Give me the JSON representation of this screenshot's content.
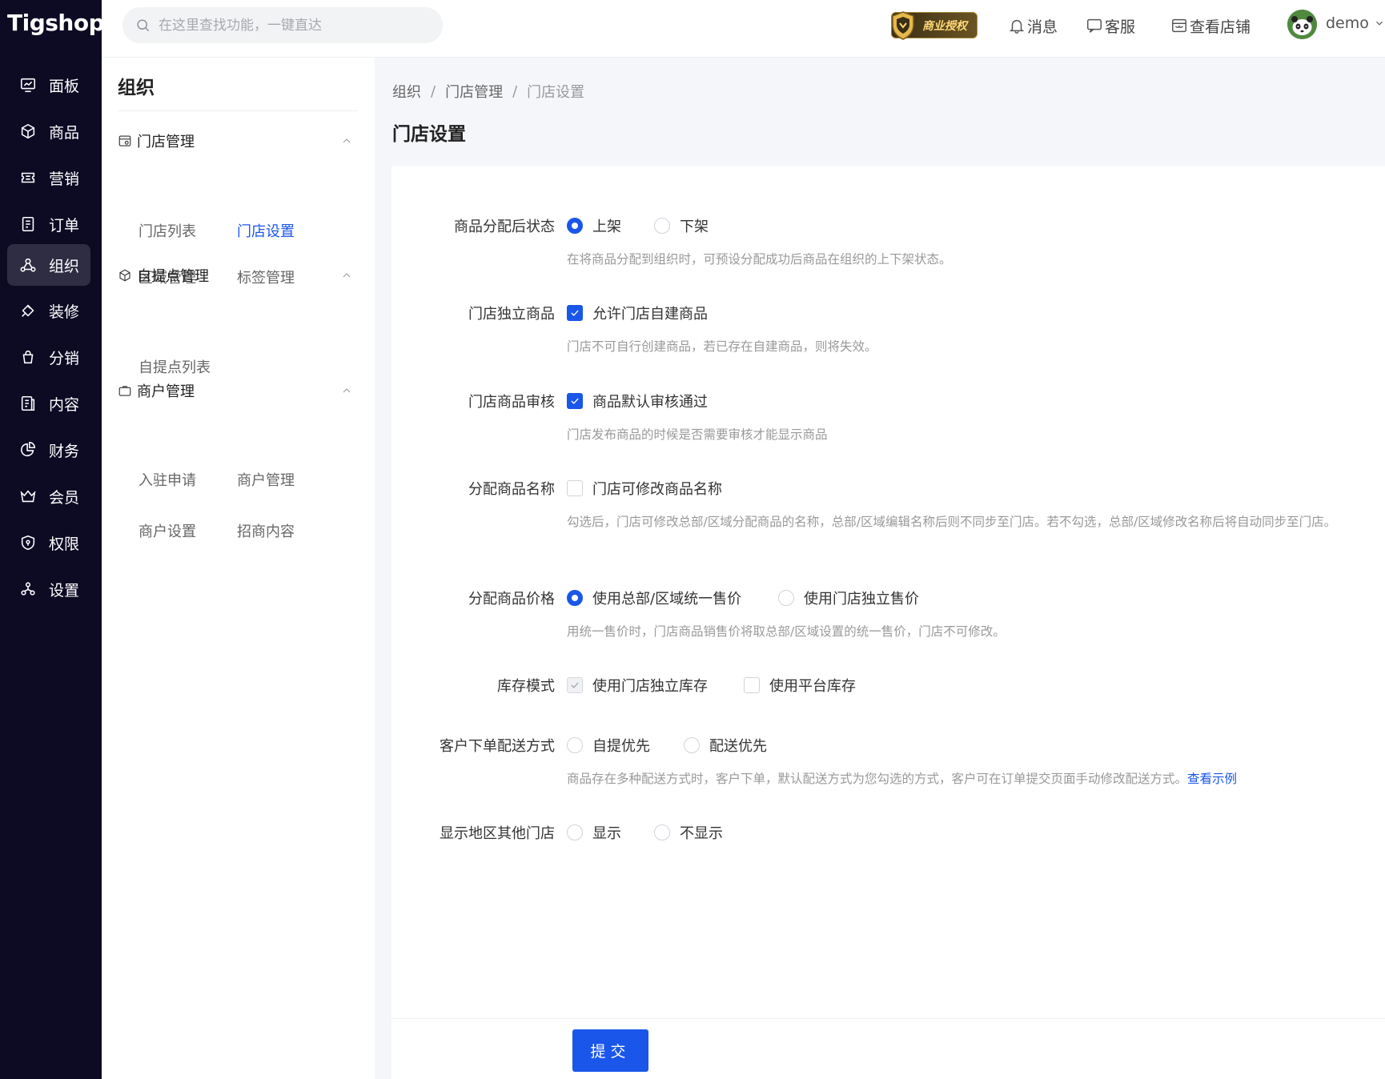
{
  "app": {
    "logo": "Tigshop"
  },
  "nav": {
    "items": [
      {
        "label": "面板"
      },
      {
        "label": "商品"
      },
      {
        "label": "营销"
      },
      {
        "label": "订单"
      },
      {
        "label": "组织"
      },
      {
        "label": "装修"
      },
      {
        "label": "分销"
      },
      {
        "label": "内容"
      },
      {
        "label": "财务"
      },
      {
        "label": "会员"
      },
      {
        "label": "权限"
      },
      {
        "label": "设置"
      }
    ],
    "active": "组织"
  },
  "header": {
    "search_placeholder": "在这里查找功能，一键直达",
    "license_badge": "商业授权",
    "messages": "消息",
    "service": "客服",
    "view_store": "查看店铺",
    "user": "demo"
  },
  "subnav": {
    "title": "组织",
    "groups": [
      {
        "label": "门店管理",
        "items": [
          {
            "label": "门店列表"
          },
          {
            "label": "门店设置"
          },
          {
            "label": "区域管理"
          },
          {
            "label": "标签管理"
          }
        ]
      },
      {
        "label": "自提点管理",
        "items": [
          {
            "label": "自提点列表"
          }
        ]
      },
      {
        "label": "商户管理",
        "items": [
          {
            "label": "入驻申请"
          },
          {
            "label": "商户管理"
          },
          {
            "label": "商户设置"
          },
          {
            "label": "招商内容"
          }
        ]
      }
    ],
    "active": "门店设置"
  },
  "breadcrumb": [
    "组织",
    "门店管理",
    "门店设置"
  ],
  "page_title": "门店设置",
  "form": {
    "r1": {
      "label": "商品分配后状态",
      "options": [
        "上架",
        "下架"
      ],
      "selected": "上架",
      "help": "在将商品分配到组织时，可预设分配成功后商品在组织的上下架状态。"
    },
    "r2": {
      "label": "门店独立商品",
      "option": "允许门店自建商品",
      "checked": true,
      "help": "门店不可自行创建商品，若已存在自建商品，则将失效。"
    },
    "r3": {
      "label": "门店商品审核",
      "option": "商品默认审核通过",
      "checked": true,
      "help": "门店发布商品的时候是否需要审核才能显示商品"
    },
    "r4": {
      "label": "分配商品名称",
      "option": "门店可修改商品名称",
      "checked": false,
      "help": "勾选后，门店可修改总部/区域分配商品的名称，总部/区域编辑名称后则不同步至门店。若不勾选，总部/区域修改名称后将自动同步至门店。"
    },
    "r5": {
      "label": "分配商品价格",
      "options": [
        "使用总部/区域统一售价",
        "使用门店独立售价"
      ],
      "selected": "使用总部/区域统一售价",
      "help": "用统一售价时，门店商品销售价将取总部/区域设置的统一售价，门店不可修改。"
    },
    "r6": {
      "label": "库存模式",
      "options": [
        "使用门店独立库存",
        "使用平台库存"
      ],
      "checked": [
        "使用门店独立库存"
      ],
      "disabled": [
        "使用门店独立库存"
      ]
    },
    "r7": {
      "label": "客户下单配送方式",
      "options": [
        "自提优先",
        "配送优先"
      ],
      "selected": null,
      "help": "商品存在多种配送方式时，客户下单，默认配送方式为您勾选的方式，客户可在订单提交页面手动修改配送方式。",
      "help_link": "查看示例"
    },
    "r8": {
      "label": "显示地区其他门店",
      "options": [
        "显示",
        "不显示"
      ],
      "selected": null
    }
  },
  "submit_label": "提交"
}
